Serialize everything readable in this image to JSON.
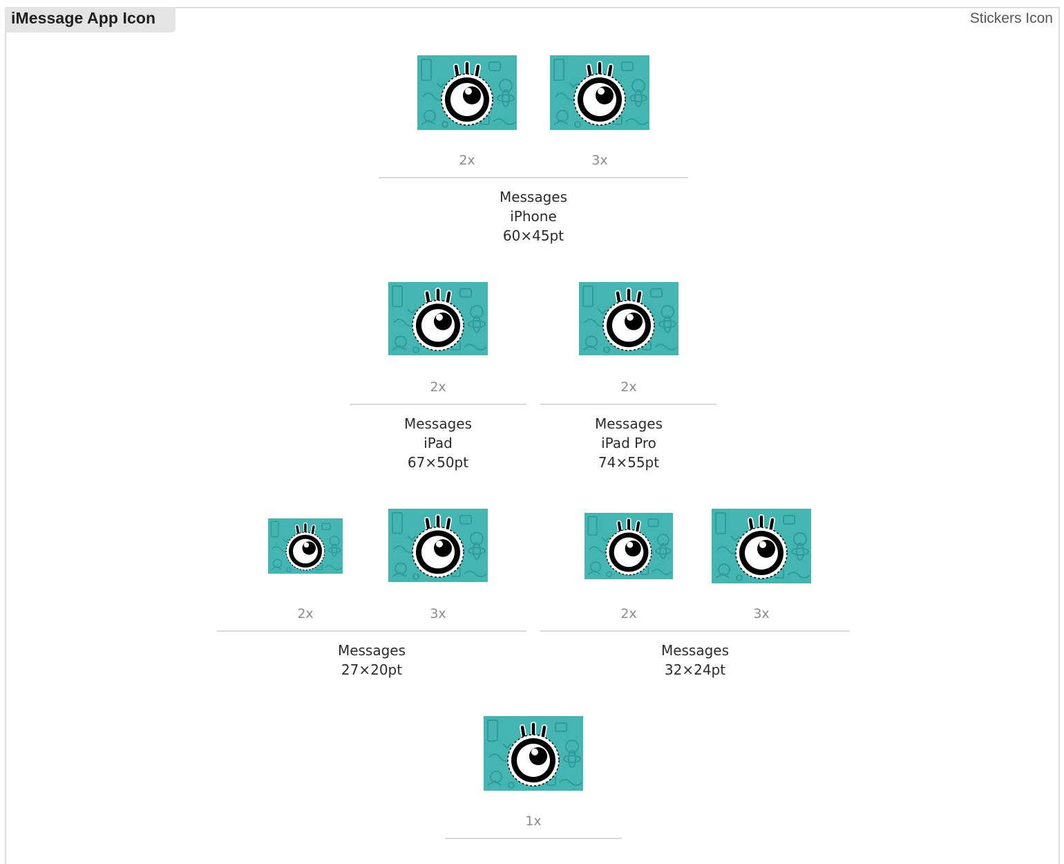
{
  "header": {
    "title": "iMessage App Icon",
    "stickers_link": "Stickers Icon"
  },
  "colors": {
    "icon_background": "#44b5b0",
    "icon_pattern": "#2f9a95",
    "divider": "#d9d9d9"
  },
  "icon_glyph": "eyeball-with-lashes-icon",
  "groups": [
    {
      "lines": [
        "Messages",
        "iPhone",
        "60×45pt"
      ],
      "slots": [
        {
          "scale": "2x"
        },
        {
          "scale": "3x"
        }
      ]
    },
    {
      "lines": [
        "Messages",
        "iPad",
        "67×50pt"
      ],
      "slots": [
        {
          "scale": "2x"
        }
      ]
    },
    {
      "lines": [
        "Messages",
        "iPad Pro",
        "74×55pt"
      ],
      "slots": [
        {
          "scale": "2x"
        }
      ]
    },
    {
      "lines": [
        "Messages",
        "27×20pt"
      ],
      "slots": [
        {
          "scale": "2x"
        },
        {
          "scale": "3x"
        }
      ]
    },
    {
      "lines": [
        "Messages",
        "32×24pt"
      ],
      "slots": [
        {
          "scale": "2x"
        },
        {
          "scale": "3x"
        }
      ]
    },
    {
      "lines": [],
      "slots": [
        {
          "scale": "1x"
        }
      ]
    }
  ]
}
